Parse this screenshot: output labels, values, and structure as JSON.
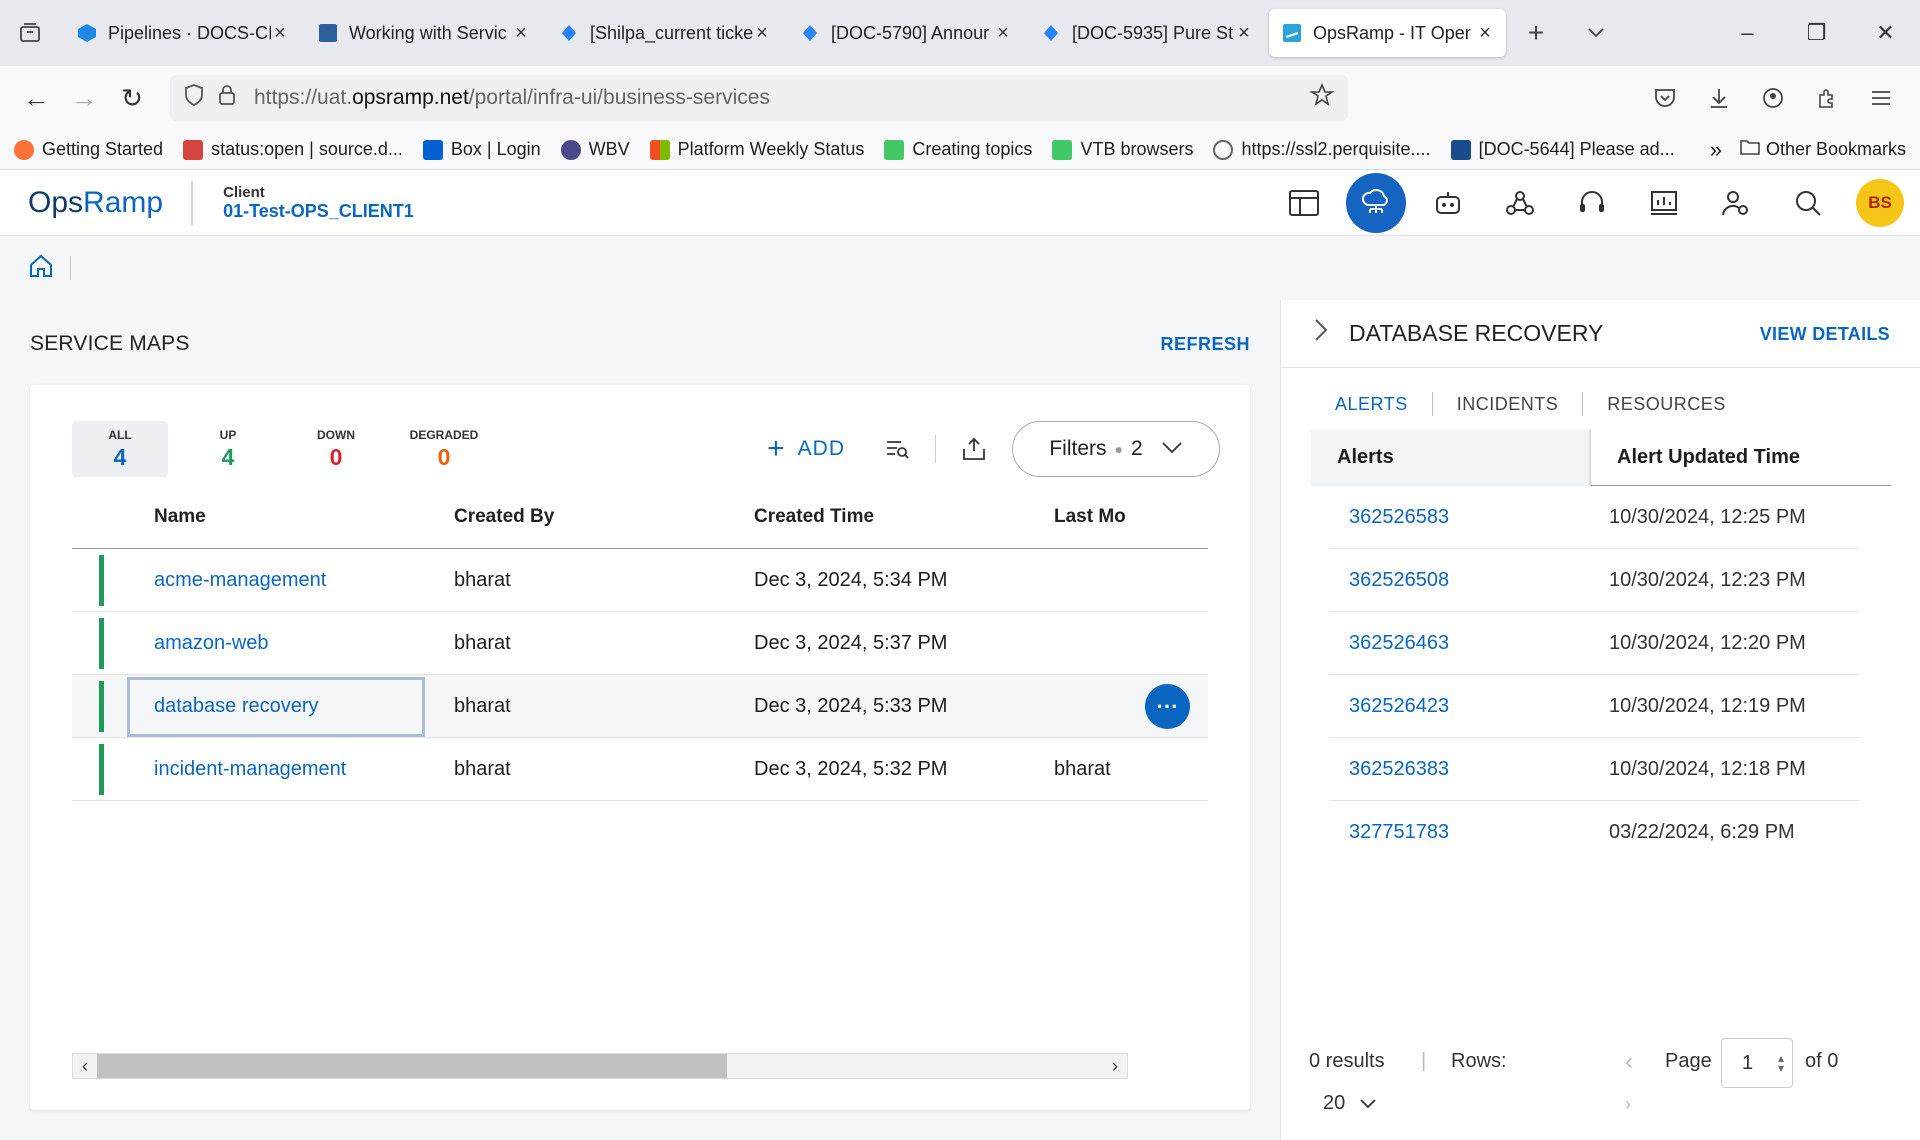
{
  "browser": {
    "tabs": [
      {
        "title": "Pipelines · DOCS-CI",
        "color": "#1e88e5"
      },
      {
        "title": "Working with Servic",
        "color": "#2d5f9a"
      },
      {
        "title": "[Shilpa_current ticke",
        "color": "#2684ff"
      },
      {
        "title": "[DOC-5790] Annour",
        "color": "#2684ff"
      },
      {
        "title": "[DOC-5935] Pure St",
        "color": "#2684ff"
      },
      {
        "title": "OpsRamp - IT Oper",
        "color": "#29a3d9"
      }
    ],
    "url_prefix": "https://uat.",
    "url_domain": "opsramp.net",
    "url_path": "/portal/infra-ui/business-services",
    "bookmarks": [
      {
        "label": "Getting Started",
        "color": "#ff7139"
      },
      {
        "label": "status:open | source.d...",
        "color": "#d6453d"
      },
      {
        "label": "Box | Login",
        "color": "#0061d5"
      },
      {
        "label": "WBV",
        "color": "#4a4a8a"
      },
      {
        "label": "Platform Weekly Status",
        "color": "#f25022"
      },
      {
        "label": "Creating topics",
        "color": "#44c767"
      },
      {
        "label": "VTB browsers",
        "color": "#44c767"
      },
      {
        "label": "https://ssl2.perquisite....",
        "color": "#666666"
      },
      {
        "label": "[DOC-5644] Please ad...",
        "color": "#1a4b8c"
      }
    ],
    "other_bookmarks": "Other Bookmarks"
  },
  "app": {
    "logo_ops": "Ops",
    "logo_ramp": "Ramp",
    "client_label": "Client",
    "client_name": "01-Test-OPS_CLIENT1",
    "avatar": "BS"
  },
  "service_maps": {
    "title": "SERVICE MAPS",
    "refresh": "REFRESH",
    "stats": [
      {
        "label": "ALL",
        "value": "4",
        "color": "#0b66c2"
      },
      {
        "label": "UP",
        "value": "4",
        "color": "#1f9a5b"
      },
      {
        "label": "DOWN",
        "value": "0",
        "color": "#d0262d"
      },
      {
        "label": "DEGRADED",
        "value": "0",
        "color": "#e8600b"
      }
    ],
    "add": "ADD",
    "filters": "Filters",
    "filters_count": "2",
    "columns": [
      "Name",
      "Created By",
      "Created Time",
      "Last Mo"
    ],
    "rows": [
      {
        "name": "acme-management",
        "by": "bharat",
        "time": "Dec 3, 2024, 5:34 PM",
        "last": ""
      },
      {
        "name": "amazon-web",
        "by": "bharat",
        "time": "Dec 3, 2024, 5:37 PM",
        "last": ""
      },
      {
        "name": "database recovery",
        "by": "bharat",
        "time": "Dec 3, 2024, 5:33 PM",
        "last": ""
      },
      {
        "name": "incident-management",
        "by": "bharat",
        "time": "Dec 3, 2024, 5:32 PM",
        "last": "bharat"
      }
    ]
  },
  "details": {
    "title": "DATABASE RECOVERY",
    "view_details": "VIEW DETAILS",
    "tabs": [
      "ALERTS",
      "INCIDENTS",
      "RESOURCES"
    ],
    "columns": [
      "Alerts",
      "Alert Updated Time"
    ],
    "alerts": [
      {
        "id": "362526583",
        "time": "10/30/2024, 12:25 PM"
      },
      {
        "id": "362526508",
        "time": "10/30/2024, 12:23 PM"
      },
      {
        "id": "362526463",
        "time": "10/30/2024, 12:20 PM"
      },
      {
        "id": "362526423",
        "time": "10/30/2024, 12:19 PM"
      },
      {
        "id": "362526383",
        "time": "10/30/2024, 12:18 PM"
      },
      {
        "id": "327751783",
        "time": "03/22/2024, 6:29 PM"
      }
    ],
    "pager": {
      "results": "0 results",
      "rows_label": "Rows:",
      "rows_value": "20",
      "page_label": "Page",
      "page_value": "1",
      "of": "of 0"
    }
  }
}
